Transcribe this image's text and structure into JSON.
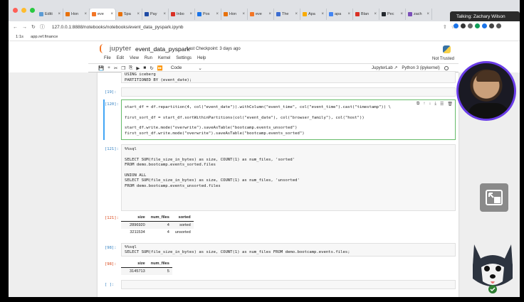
{
  "browser": {
    "traffic_colors": [
      "#ff5f57",
      "#febc2e",
      "#28c840"
    ],
    "tabs": [
      {
        "label": "Editi",
        "color": "#5b9bd5"
      },
      {
        "label": "Hon",
        "color": "#e8710a"
      },
      {
        "label": "eve",
        "color": "#f37626",
        "active": true
      },
      {
        "label": "Spa",
        "color": "#e8710a"
      },
      {
        "label": "Pay",
        "color": "#1f4ba5"
      },
      {
        "label": "Inbo",
        "color": "#d93025"
      },
      {
        "label": "Pos",
        "color": "#1a73e8"
      },
      {
        "label": "Hon",
        "color": "#e8710a"
      },
      {
        "label": "eve",
        "color": "#f37626"
      },
      {
        "label": "The",
        "color": "#3c6dd1"
      },
      {
        "label": "Apa",
        "color": "#f9ab00"
      },
      {
        "label": "apa",
        "color": "#4285f4"
      },
      {
        "label": "Blan",
        "color": "#d93025"
      },
      {
        "label": "Pec",
        "color": "#24292f"
      },
      {
        "label": "zach",
        "color": "#7b4fb8"
      }
    ],
    "talking_label": "Talking: Zachary Wilson",
    "url": "127.0.0.1:8888/notebooks/notebooks/event_data_pyspark.ipynb",
    "bookmarks": [
      "1:1s",
      "app.ref.finance"
    ]
  },
  "jupyter": {
    "logo_text": "jupyter",
    "notebook_name": "event_data_pyspark",
    "checkpoint": "Last Checkpoint: 3 days ago",
    "menu": [
      "File",
      "Edit",
      "View",
      "Run",
      "Kernel",
      "Settings",
      "Help"
    ],
    "trusted": "Not Trusted",
    "toolbar": [
      "💾",
      "+",
      "✂",
      "❐",
      "⎘",
      "▶",
      "■",
      "↻",
      "⏩"
    ],
    "cell_type": "Code",
    "jupyterlab_link": "JupyterLab ↗",
    "kernel": "Python 3 (ipykernel)"
  },
  "cells": {
    "c0_lines": [
      "USING iceberg",
      "PARTITIONED BY (event_date);"
    ],
    "c1_prompt": "[19]:",
    "c2_prompt": "[120]:",
    "c2_lines": [
      "start_df = df.repartition(4, col(\"event_date\")).withColumn(\"event_time\", col(\"event_time\").cast(\"timestamp\")) \\",
      "",
      "first_sort_df = start_df.sortWithinPartitions(col(\"event_date\"), col(\"browser_family\"), col(\"host\"))",
      "",
      "start_df.write.mode(\"overwrite\").saveAsTable(\"bootcamp.events_unsorted\")",
      "first_sort_df.write.mode(\"overwrite\").saveAsTable(\"bootcamp.events_sorted\")"
    ],
    "c3_prompt": "[121]:",
    "c3_lines": [
      "%%sql",
      "",
      "SELECT SUM(file_size_in_bytes) as size, COUNT(1) as num_files, 'sorted'",
      "FROM demo.bootcamp.events_sorted.files",
      "",
      "UNION ALL",
      "SELECT SUM(file_size_in_bytes) as size, COUNT(1) as num_files, 'unsorted'",
      "FROM demo.bootcamp.events_unsorted.files"
    ],
    "o3_prompt": "[121]:",
    "o3_headers": [
      "size",
      "num_files",
      "sorted"
    ],
    "o3_rows": [
      [
        "2896920",
        "4",
        "sorted"
      ],
      [
        "3211534",
        "4",
        "unsorted"
      ]
    ],
    "c4_prompt": "[98]:",
    "c4_lines": [
      "%%sql",
      "SELECT SUM(file_size_in_bytes) as size, COUNT(1) as num_files FROM demo.bootcamp.events.files;"
    ],
    "o4_prompt": "[98]:",
    "o4_headers": [
      "size",
      "num_files"
    ],
    "o4_rows": [
      [
        "3145713",
        "5"
      ]
    ],
    "c5_prompt": "[ ]:"
  }
}
